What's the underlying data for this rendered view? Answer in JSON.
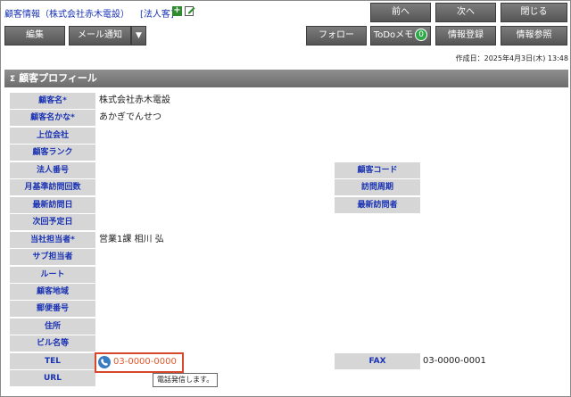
{
  "header": {
    "title": "顧客情報（株式会社赤木電設）",
    "badge": "[法人客]",
    "plus_icon": "plus-icon",
    "edit_icon": "edit-icon"
  },
  "buttons": {
    "prev": "前へ",
    "next": "次へ",
    "close": "閉じる",
    "edit": "編集",
    "mail": "メール通知",
    "follow": "フォロー",
    "todo": "ToDoメモ",
    "todo_count": "0",
    "register": "情報登録",
    "reference": "情報参照"
  },
  "created": "作成日：2025年4月3日(木) 13:48",
  "section": {
    "title": "顧客プロフィール",
    "icon": "sigma-icon"
  },
  "fields": [
    {
      "label": "顧客名*",
      "value": "株式会社赤木電設"
    },
    {
      "label": "顧客名かな*",
      "value": "あかぎでんせつ"
    },
    {
      "label": "上位会社",
      "value": ""
    },
    {
      "label": "顧客ランク",
      "value": ""
    },
    {
      "label": "法人番号",
      "value": "",
      "label2": "顧客コード",
      "value2": ""
    },
    {
      "label": "月基準訪問回数",
      "value": "",
      "label2": "訪問周期",
      "value2": ""
    },
    {
      "label": "最新訪問日",
      "value": "",
      "label2": "最新訪問者",
      "value2": ""
    },
    {
      "label": "次回予定日",
      "value": ""
    },
    {
      "label": "当社担当者*",
      "value": "営業1課 相川 弘"
    },
    {
      "label": "サブ担当者",
      "value": ""
    },
    {
      "label": "ルート",
      "value": ""
    },
    {
      "label": "顧客地域",
      "value": ""
    },
    {
      "label": "郵便番号",
      "value": ""
    },
    {
      "label": "住所",
      "value": ""
    },
    {
      "label": "ビル名等",
      "value": ""
    },
    {
      "label": "TEL",
      "value": "03-0000-0000",
      "label2": "FAX",
      "value2": "03-0000-0001"
    },
    {
      "label": "URL",
      "value": ""
    }
  ],
  "tooltip": "電話発信します。",
  "colors": {
    "accent": "#1a33b3",
    "highlight": "#d6472c",
    "link": "#e2582c"
  }
}
